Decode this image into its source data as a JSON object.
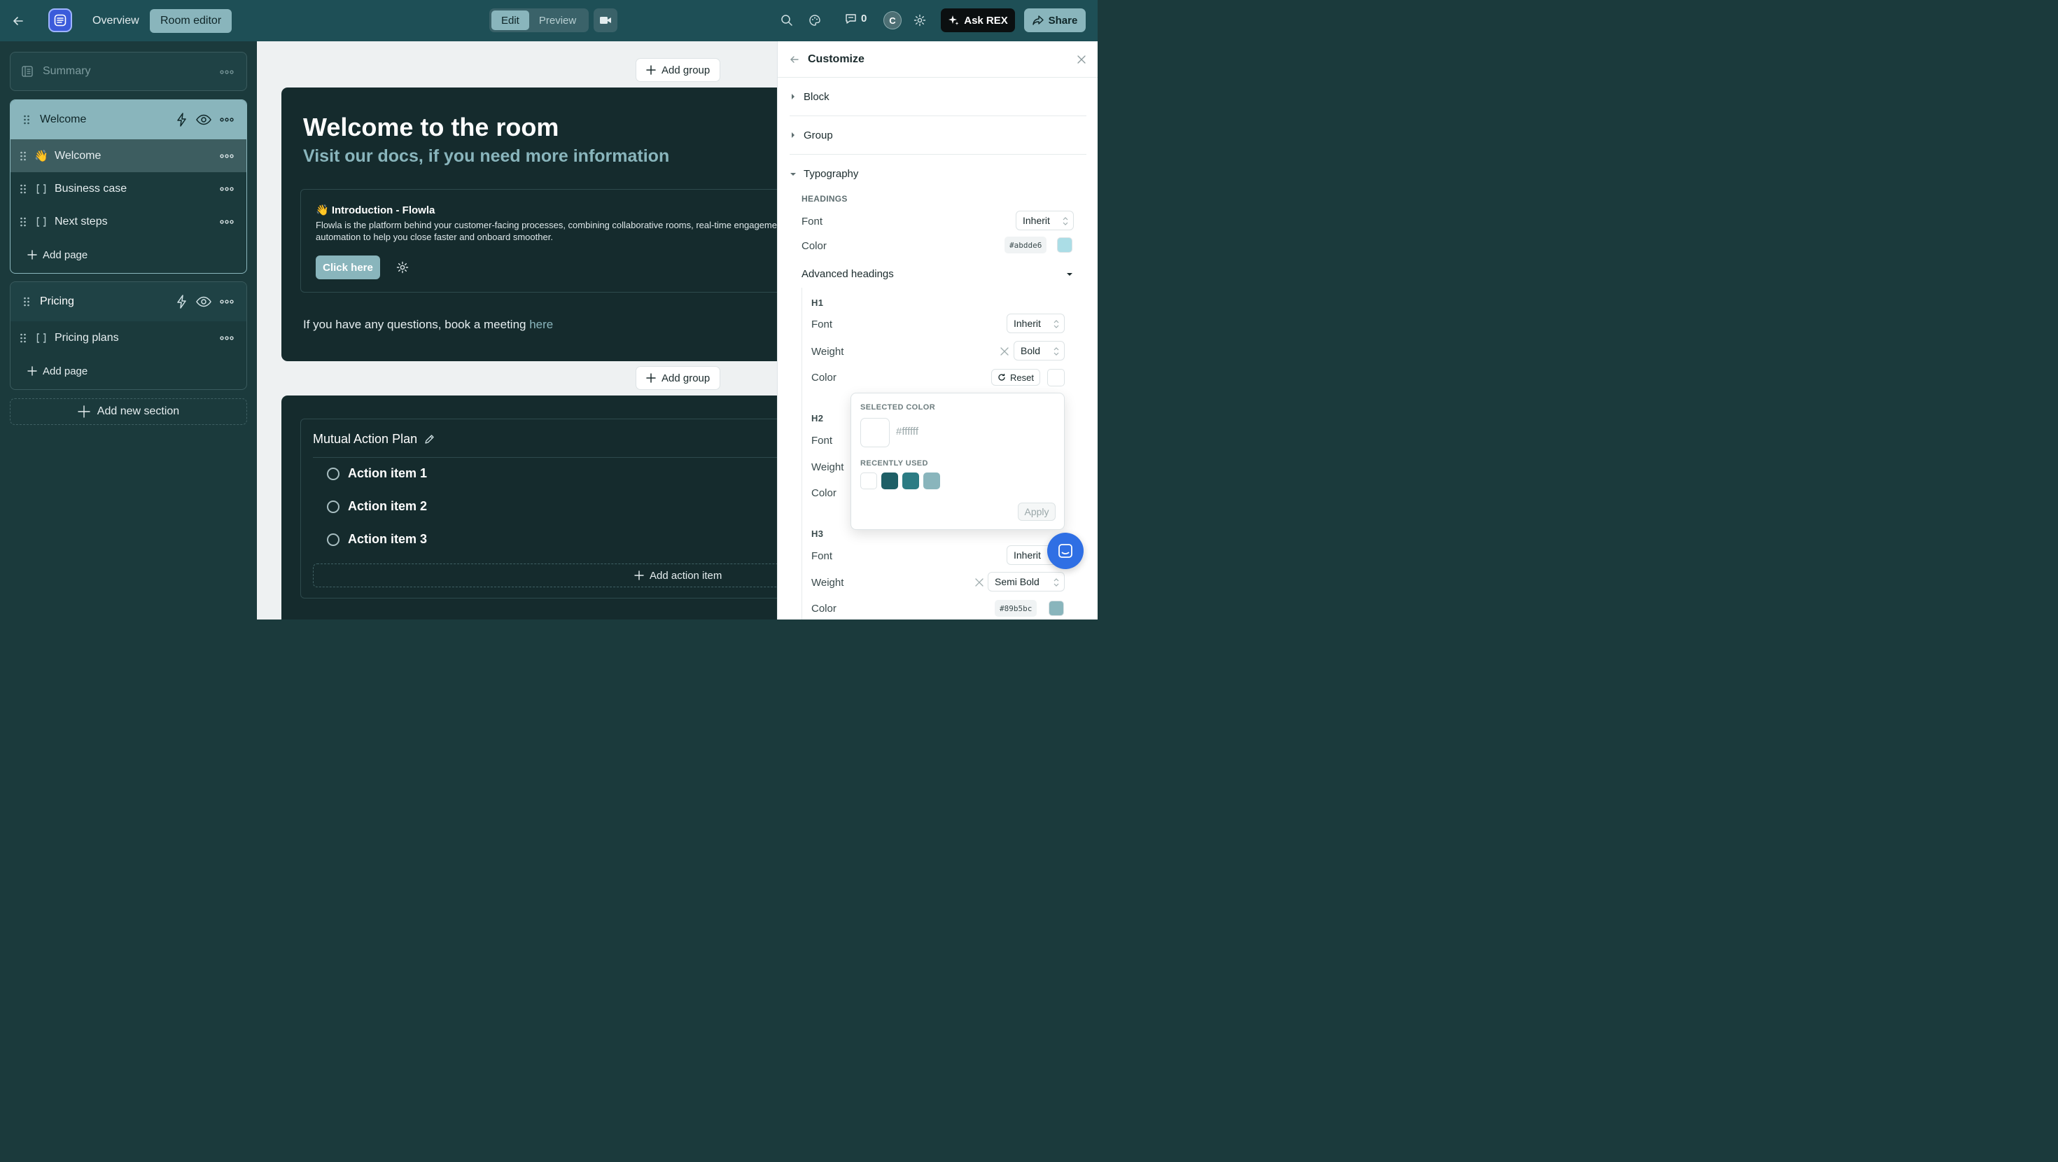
{
  "topbar": {
    "tabs": [
      {
        "label": "Overview",
        "active": false
      },
      {
        "label": "Room editor",
        "active": true
      }
    ],
    "mode": {
      "edit": "Edit",
      "preview": "Preview",
      "selected": "Edit"
    },
    "comment_count": "0",
    "avatar_initial": "C",
    "ask_rex_label": "Ask REX",
    "share_label": "Share"
  },
  "sidebar": {
    "summary_label": "Summary",
    "sections": [
      {
        "title": "Welcome",
        "pages": [
          {
            "label": "Welcome",
            "icon": "wave-emoji",
            "glyph": "👋",
            "selected": true
          },
          {
            "label": "Business case",
            "icon": "page-bracket-icon",
            "glyph": "[ ]"
          },
          {
            "label": "Next steps",
            "icon": "page-bracket-icon",
            "glyph": "[ ]"
          }
        ],
        "add_page_label": "Add page"
      },
      {
        "title": "Pricing",
        "pages": [
          {
            "label": "Pricing plans",
            "icon": "page-bracket-icon",
            "glyph": "[ ]"
          }
        ],
        "add_page_label": "Add page"
      }
    ],
    "add_section_label": "Add new section"
  },
  "canvas": {
    "add_group_label": "Add group",
    "group1": {
      "title": "Welcome to the room",
      "subtitle": "Visit our docs, if you need more information",
      "intro_title": "👋 Introduction - Flowla",
      "intro_text": "Flowla is the platform behind your customer-facing processes, combining collaborative rooms, real-time engagement and automation to help you close faster and onboard smoother.",
      "button_label": "Click here",
      "meeting_text": "If you have any questions, book a meeting ",
      "meeting_link": "here"
    },
    "group2": {
      "map_title": "Mutual Action Plan",
      "actions": [
        "Action item 1",
        "Action item 2",
        "Action item 3"
      ],
      "add_action_label": "Add action item"
    }
  },
  "panel": {
    "title": "Customize",
    "block_label": "Block",
    "group_label": "Group",
    "typography_label": "Typography",
    "headings_caption": "HEADINGS",
    "font_label": "Font",
    "color_label": "Color",
    "weight_label": "Weight",
    "inherit": "Inherit",
    "headings_color": "#abdde6",
    "advanced_label": "Advanced headings",
    "h1_label": "H1",
    "h1_weight": "Bold",
    "reset_label": "Reset",
    "h2_label": "H2",
    "h3_label": "H3",
    "h3_weight": "Semi Bold",
    "h3_color": "#89b5bc",
    "picker": {
      "selected_caption": "SELECTED COLOR",
      "selected_hex": "#ffffff",
      "recent_caption": "RECENTLY USED",
      "recent_colors": [
        "#ffffff",
        "#1e5f66",
        "#2c7c84",
        "#89b5bc"
      ],
      "apply_label": "Apply"
    }
  }
}
